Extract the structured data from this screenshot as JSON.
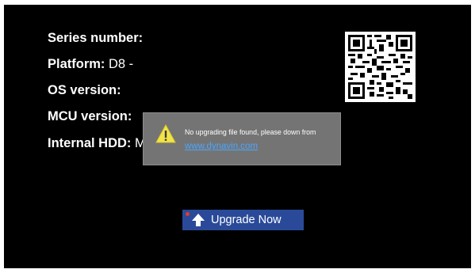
{
  "info": {
    "series_label": "Series number:",
    "series_value": "",
    "platform_label": "Platform:",
    "platform_value": " D8 -",
    "os_label": "OS version:",
    "os_value": "",
    "mcu_label": "MCU version:",
    "mcu_value": "",
    "hdd_label": "Internal HDD:",
    "hdd_value": " M"
  },
  "dialog": {
    "icon": "warning-icon",
    "message": "No upgrading file found, please down from",
    "link": "www.dynavin.com"
  },
  "upgrade_button": {
    "icon": "arrow-up-icon",
    "label": "Upgrade Now"
  },
  "colors": {
    "screen_background": "#000000",
    "dialog_background": "#747474",
    "link": "#4aa6ff",
    "button_background": "#2a4a99",
    "warning": "#f2e34a"
  }
}
